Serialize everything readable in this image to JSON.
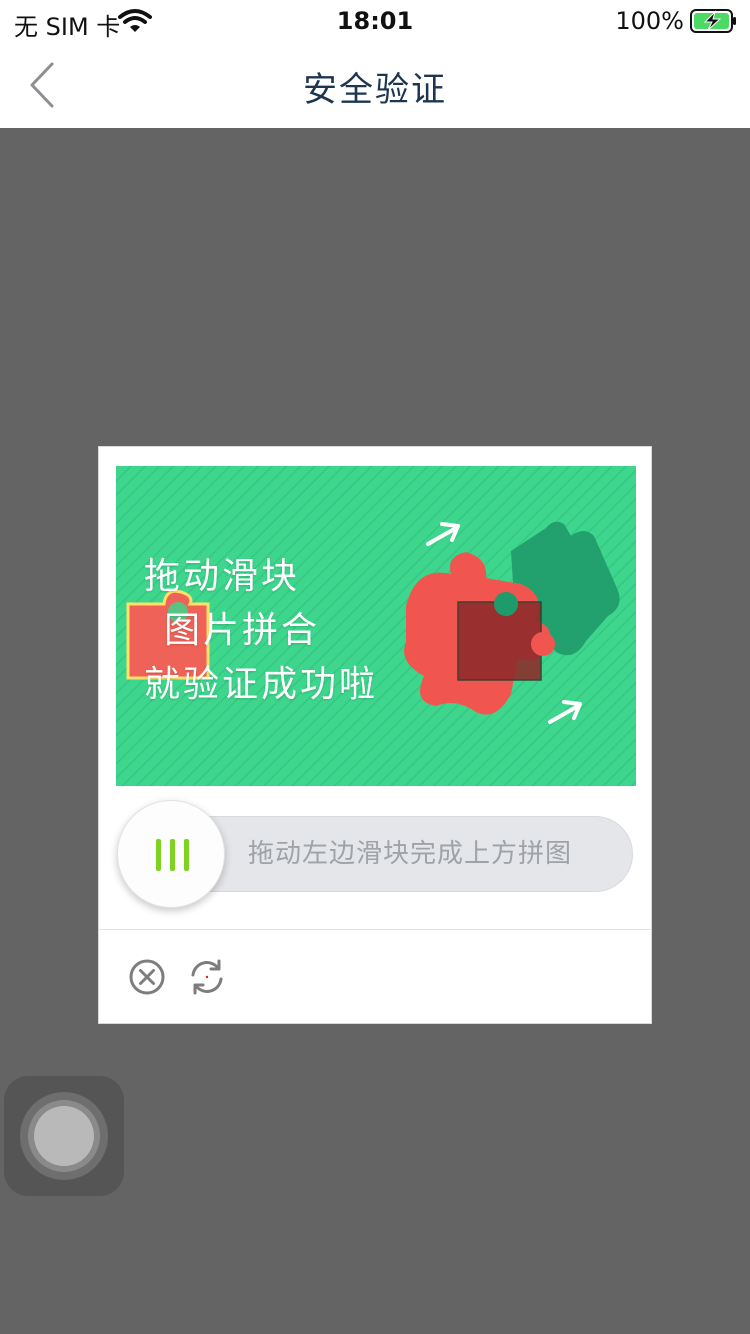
{
  "status_bar": {
    "carrier": "无 SIM 卡",
    "time": "18:01",
    "battery_percent": "100%",
    "wifi_icon": "wifi-icon",
    "battery_icon": "battery-charging-icon"
  },
  "nav": {
    "back_icon": "chevron-left-icon",
    "title": "安全验证"
  },
  "captcha": {
    "image": {
      "lines": [
        "拖动滑块",
        "图片拼合",
        "就验证成功啦"
      ],
      "colors": {
        "background": "#3dd68c",
        "puzzle_red": "#f0564f",
        "puzzle_green": "#1f9a6a"
      }
    },
    "slider": {
      "hint": "拖动左边滑块完成上方拼图",
      "knob_icon": "drag-handle-icon",
      "handle_color": "#7ed321"
    },
    "footer": {
      "close_icon": "close-circle-icon",
      "refresh_icon": "refresh-icon"
    }
  },
  "assistive_touch_icon": "assistive-touch-icon"
}
